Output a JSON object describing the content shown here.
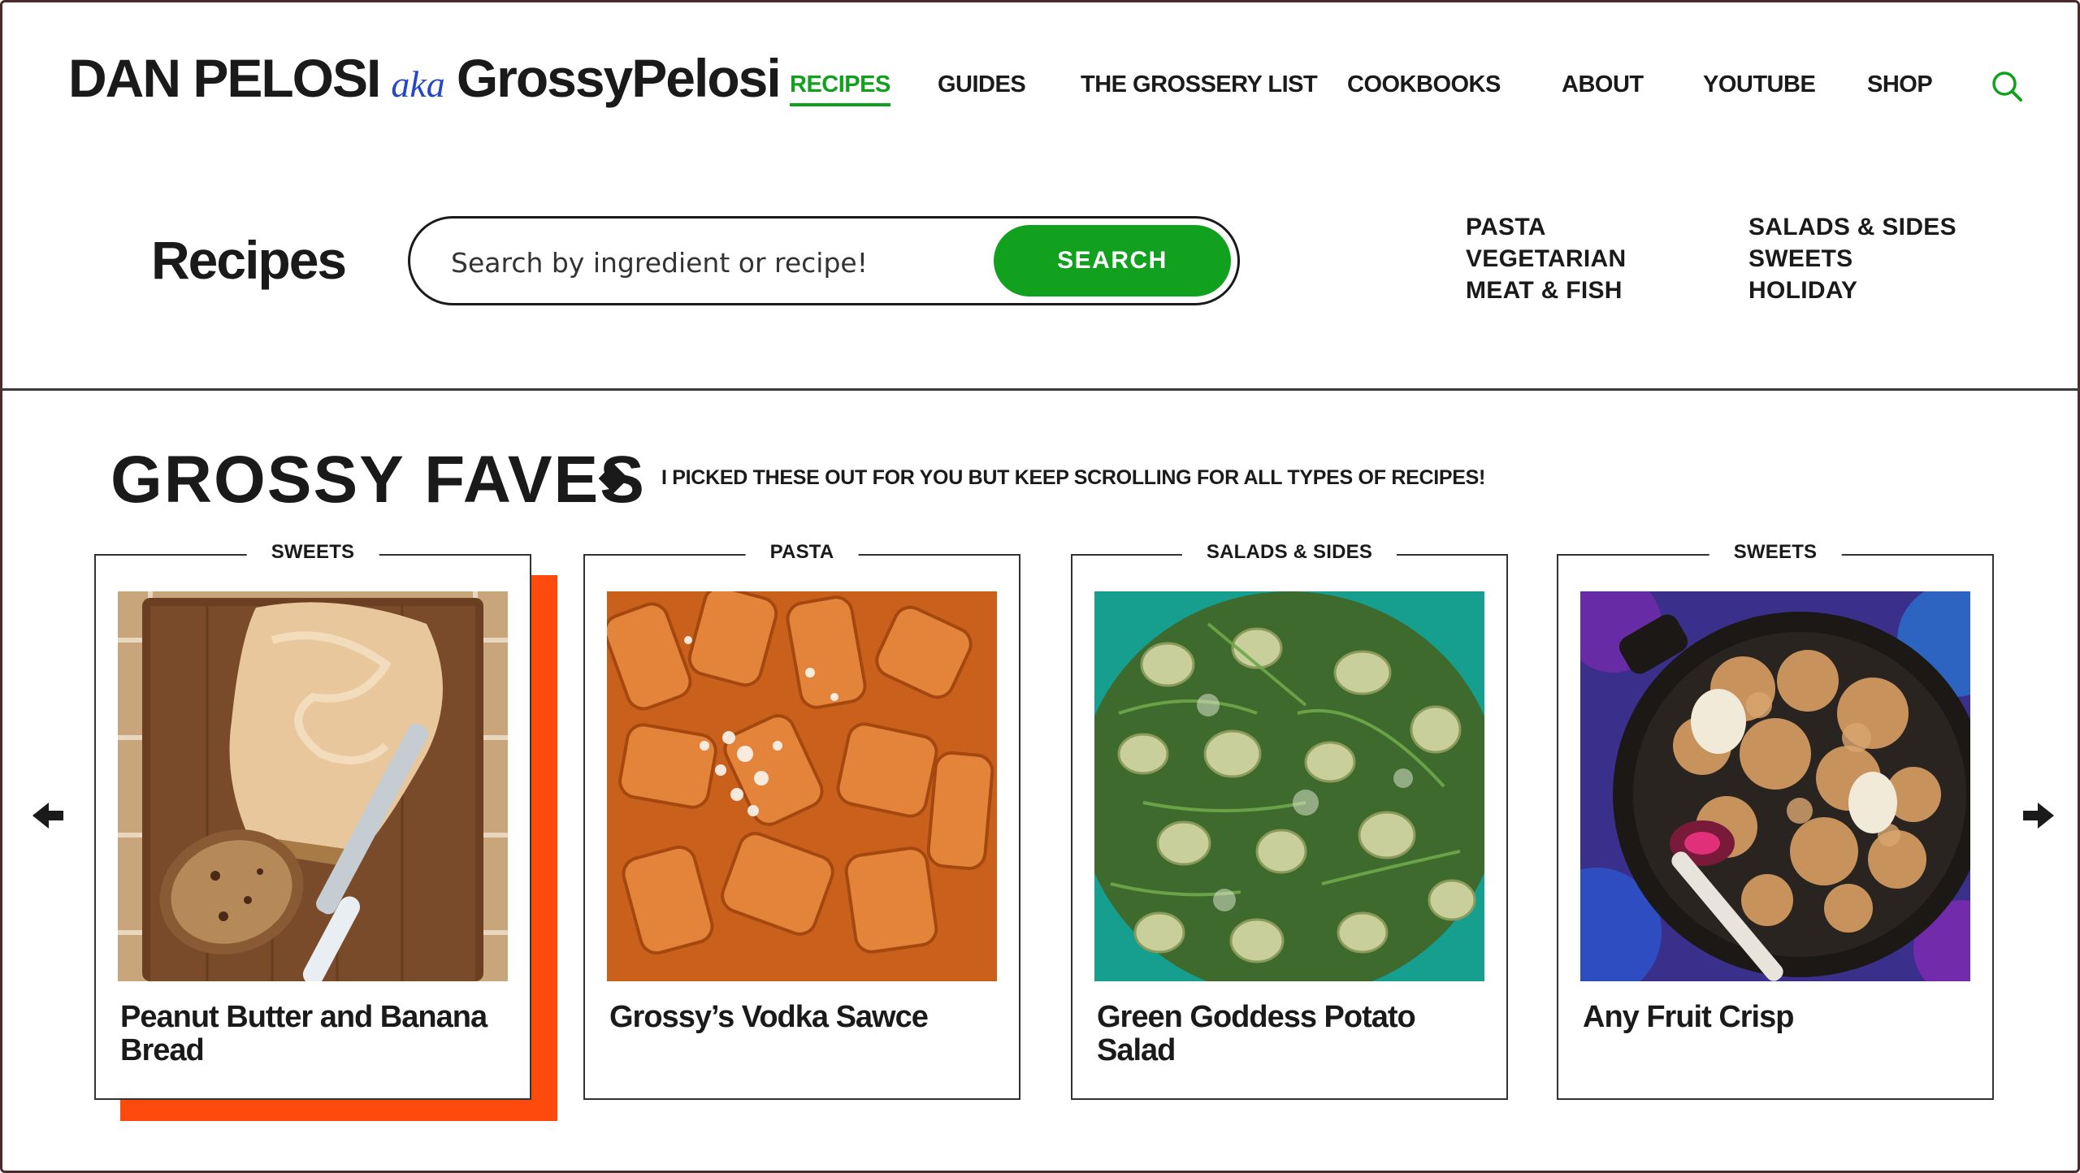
{
  "brand": {
    "name_main": "DAN PELOSI",
    "name_aka": "aka",
    "name_handle": "GrossyPelosi"
  },
  "nav": {
    "items": [
      {
        "label": "RECIPES",
        "active": true
      },
      {
        "label": "GUIDES",
        "active": false
      },
      {
        "label": "THE GROSSERY LIST",
        "active": false
      },
      {
        "label": "COOKBOOKS",
        "active": false
      },
      {
        "label": "ABOUT",
        "active": false
      },
      {
        "label": "YOUTUBE",
        "active": false
      },
      {
        "label": "SHOP",
        "active": false
      }
    ],
    "search_icon": "search-icon"
  },
  "recipes_bar": {
    "title": "Recipes",
    "search_placeholder": "Search by ingredient or recipe!",
    "search_button": "SEARCH",
    "categories_left": [
      "PASTA",
      "VEGETARIAN",
      "MEAT & FISH"
    ],
    "categories_right": [
      "SALADS & SIDES",
      "SWEETS",
      "HOLIDAY"
    ]
  },
  "faves": {
    "title": "GROSSY FAVES",
    "subtitle": "I PICKED THESE OUT FOR YOU  BUT KEEP SCROLLING FOR ALL TYPES OF RECIPES!",
    "cards": [
      {
        "category": "SWEETS",
        "name": "Peanut Butter and Banana Bread",
        "image": "peanut-butter-banana-bread-photo",
        "highlighted": true
      },
      {
        "category": "PASTA",
        "name": "Grossy’s Vodka Sawce",
        "image": "vodka-sauce-pasta-photo",
        "highlighted": false
      },
      {
        "category": "SALADS & SIDES",
        "name": "Green Goddess Potato Salad",
        "image": "green-goddess-potato-salad-photo",
        "highlighted": false
      },
      {
        "category": "SWEETS",
        "name": "Any Fruit Crisp",
        "image": "fruit-crisp-photo",
        "highlighted": false
      }
    ]
  },
  "colors": {
    "accent_green": "#11a11e",
    "highlight_orange": "#ff4a0e",
    "aka_blue": "#2446c8",
    "text": "#1a1a1a"
  }
}
